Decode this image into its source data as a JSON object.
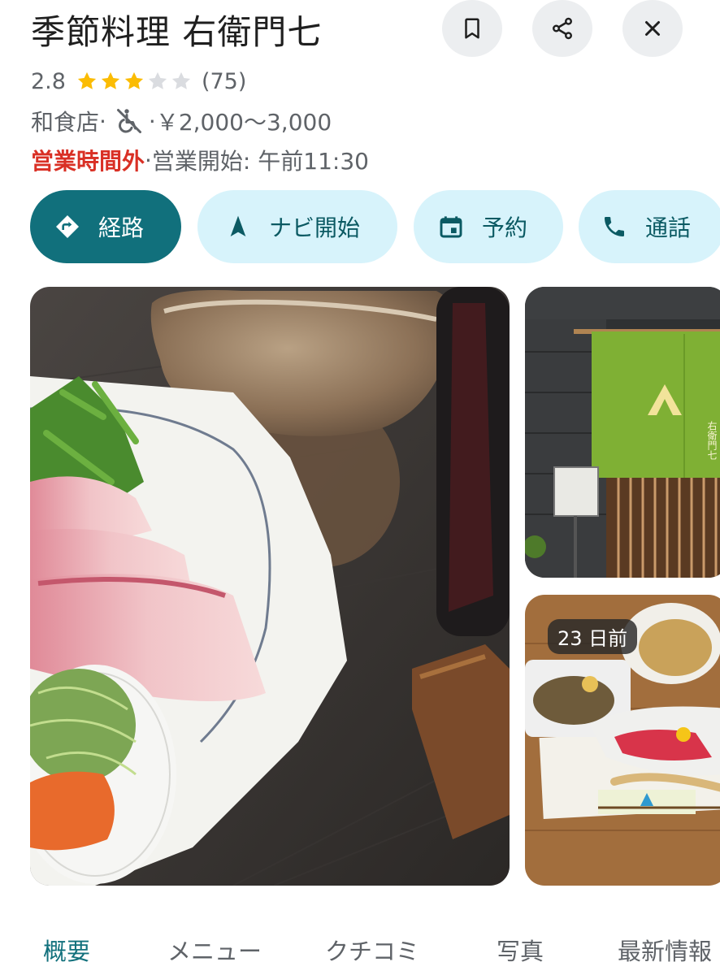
{
  "place": {
    "name": "季節料理 右衛門七",
    "rating": "2.8",
    "rating_value": 2.8,
    "review_count": "(75)",
    "category": "和食店",
    "sep1": " · ",
    "sep2": " · ",
    "price_range": "￥2,000〜3,000",
    "status": "営業時間外",
    "status_sep": " · ",
    "opening_text": "営業開始: 午前11:30",
    "icons": {
      "accessibility": "no-wheelchair-icon"
    }
  },
  "header_buttons": [
    {
      "name": "save",
      "icon": "bookmark-icon"
    },
    {
      "name": "share",
      "icon": "share-icon"
    },
    {
      "name": "close",
      "icon": "close-icon"
    }
  ],
  "actions": [
    {
      "label": "経路",
      "icon": "directions-icon"
    },
    {
      "label": "ナビ開始",
      "icon": "navigation-icon"
    },
    {
      "label": "予約",
      "icon": "calendar-icon"
    },
    {
      "label": "通話",
      "icon": "phone-icon"
    }
  ],
  "photos": {
    "main": "sashimi-plate-photo",
    "storefront": "storefront-noren-photo",
    "recent": {
      "badge": "23 日前",
      "subject": "set-meal-photo"
    }
  },
  "tabs": [
    {
      "label": "概要",
      "active": true
    },
    {
      "label": "メニュー",
      "active": false
    },
    {
      "label": "クチコミ",
      "active": false
    },
    {
      "label": "写真",
      "active": false
    },
    {
      "label": "最新情報",
      "active": false
    }
  ],
  "colors": {
    "accent": "#11707c",
    "action_secondary_bg": "#d7f3fb",
    "star": "#fbbc04",
    "star_empty": "#dadce0",
    "closed": "#d93025"
  }
}
